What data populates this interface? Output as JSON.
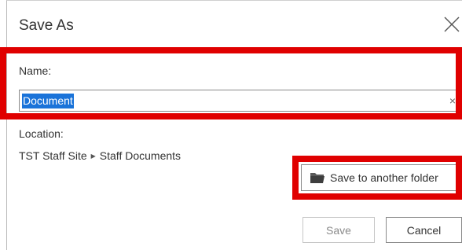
{
  "dialog": {
    "title": "Save As",
    "close_icon": "close-icon"
  },
  "name_section": {
    "label": "Name:",
    "value": "Document",
    "clear_glyph": "×",
    "highlight_color": "#e00000"
  },
  "location_section": {
    "label": "Location:",
    "breadcrumb": [
      "TST Staff Site",
      "Staff Documents"
    ],
    "separator_glyph": "▶"
  },
  "folder_button": {
    "label": "Save to another folder",
    "icon": "folder-open-icon"
  },
  "buttons": {
    "save": "Save",
    "cancel": "Cancel"
  },
  "colors": {
    "selection": "#1a73d9",
    "highlight": "#e00000"
  }
}
